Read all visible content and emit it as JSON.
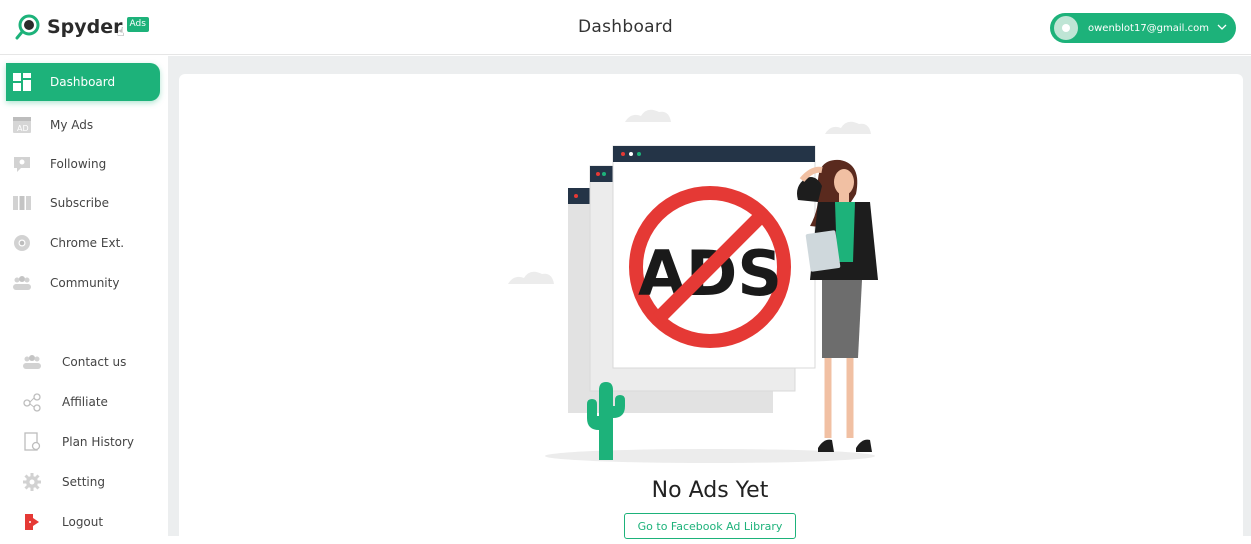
{
  "brand": {
    "name": "Spyder",
    "badge": "Ads"
  },
  "header": {
    "title": "Dashboard"
  },
  "user": {
    "email": "owenblot17@gmail.com"
  },
  "sidebar": {
    "items": [
      {
        "label": "Dashboard",
        "icon": "dashboard-icon",
        "active": true
      },
      {
        "label": "My Ads",
        "icon": "ad-icon"
      },
      {
        "label": "Following",
        "icon": "following-icon"
      },
      {
        "label": "Subscribe",
        "icon": "subscribe-icon"
      },
      {
        "label": "Chrome Ext.",
        "icon": "chrome-icon"
      },
      {
        "label": "Community",
        "icon": "community-icon"
      }
    ],
    "lower_items": [
      {
        "label": "Contact us",
        "icon": "contact-icon"
      },
      {
        "label": "Affiliate",
        "icon": "affiliate-icon"
      },
      {
        "label": "Plan History",
        "icon": "plan-history-icon"
      },
      {
        "label": "Setting",
        "icon": "gear-icon"
      },
      {
        "label": "Logout",
        "icon": "logout-icon"
      }
    ]
  },
  "empty_state": {
    "title": "No Ads Yet",
    "illustration_text": "ADS",
    "button_label": "Go to Facebook Ad Library"
  },
  "colors": {
    "accent": "#1db27a",
    "danger": "#e53935",
    "dark": "#243447"
  }
}
